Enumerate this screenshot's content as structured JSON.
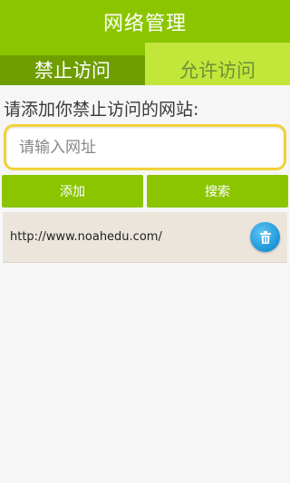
{
  "header": {
    "title": "网络管理"
  },
  "tabs": [
    {
      "label": "禁止访问",
      "active": true
    },
    {
      "label": "允许访问",
      "active": false
    }
  ],
  "form": {
    "prompt": "请添加你禁止访问的网站:",
    "input_value": "",
    "input_placeholder": "请输入网址",
    "add_label": "添加",
    "search_label": "搜索"
  },
  "blocked_sites": [
    {
      "url": "http://www.noahedu.com/",
      "action_icon": "trash-icon"
    }
  ],
  "colors": {
    "accent": "#8bc500",
    "tab_active": "#6e9e00",
    "tab_inactive": "#c2e63a",
    "input_border": "#f0d23a",
    "delete_button": "#1b95d8"
  }
}
